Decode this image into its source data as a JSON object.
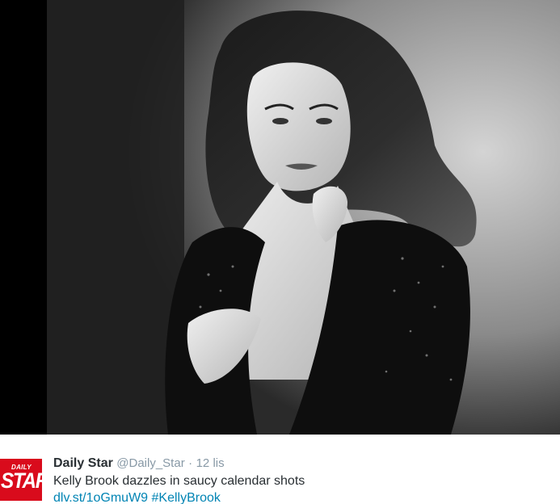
{
  "tweet": {
    "display_name": "Daily Star",
    "handle": "@Daily_Star",
    "separator": "·",
    "time": "12 lis",
    "text": "Kelly Brook dazzles in saucy calendar shots",
    "link": "dlv.st/1oGmuW9",
    "hashtag": "#KellyBrook"
  },
  "avatar": {
    "small_text": "DAILY",
    "big_text": "STAR",
    "color": "#d90b1c"
  },
  "colors": {
    "name": "#292f33",
    "meta": "#8899a6",
    "link": "#0084b4"
  }
}
